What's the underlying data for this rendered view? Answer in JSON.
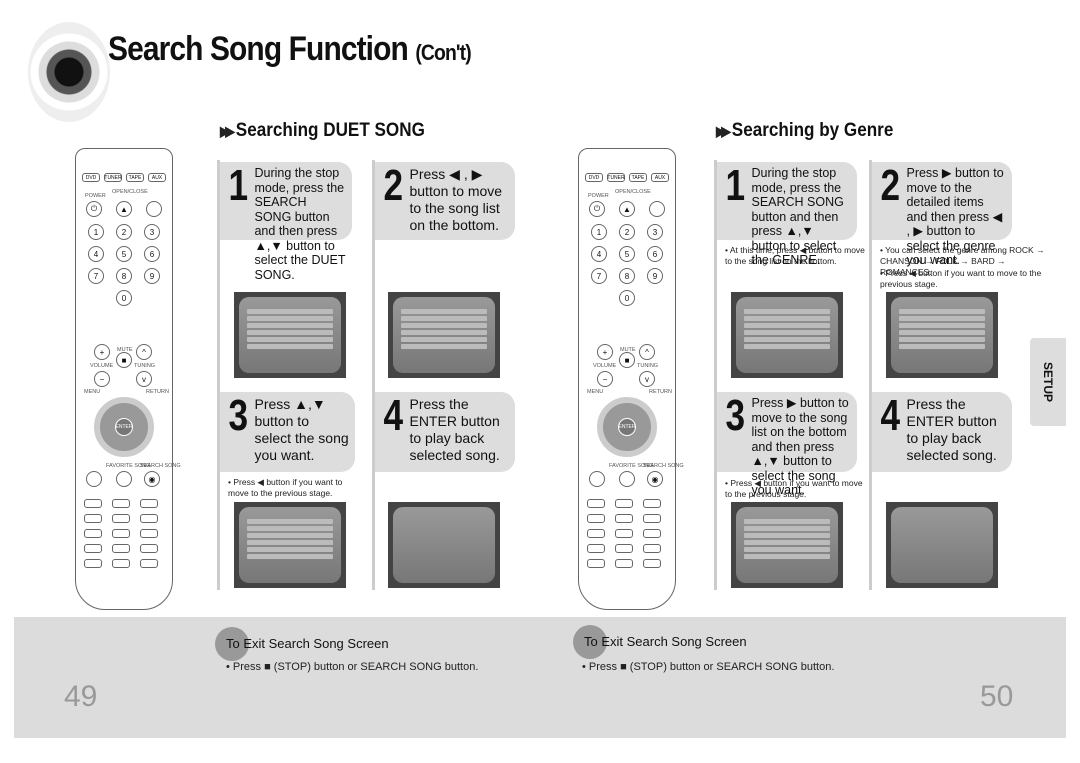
{
  "title": {
    "main": "Search Song Function",
    "suffix": "(Con't)"
  },
  "left": {
    "heading": "Searching DUET SONG",
    "steps": [
      {
        "n": "1",
        "text": "During the stop mode, press the SEARCH SONG button and then press ▲,▼ button to select the DUET SONG."
      },
      {
        "n": "2",
        "text": "Press ◀ , ▶ button to move to the song list on the bottom."
      },
      {
        "n": "3",
        "text": "Press ▲,▼ button to select the song you want."
      },
      {
        "n": "4",
        "text": "Press the ENTER button to play back selected song."
      }
    ],
    "note3": "• Press ◀ button if you want to move to the previous stage."
  },
  "right": {
    "heading": "Searching by Genre",
    "steps": [
      {
        "n": "1",
        "text": "During the stop mode, press the SEARCH SONG button and then press ▲,▼ button to select the GENRE."
      },
      {
        "n": "2",
        "text": "Press ▶ button to move to the detailed items and then press ◀ , ▶ button to select the genre you want."
      },
      {
        "n": "3",
        "text": "Press ▶ button to move to the song list on the bottom and then press ▲,▼ button to select the song you want."
      },
      {
        "n": "4",
        "text": "Press the ENTER button to play back selected song."
      }
    ],
    "note1": "• At this time, press ◀ button to move to the song list on the bottom.",
    "note2a": "• You can select the genre among ROCK → CHANSON → FOLK → BARD → ROMANCES.",
    "note2b": "• Press ◀ button if you want to move to the previous stage.",
    "note3": "• Press ◀ button if you want to move to the previous stage."
  },
  "remote": {
    "top_keys": [
      "DVD",
      "TUNER",
      "TAPE",
      "AUX"
    ],
    "numbers": [
      "1",
      "2",
      "3",
      "4",
      "5",
      "6",
      "7",
      "8",
      "9",
      "0"
    ],
    "labels": {
      "power": "POWER",
      "open": "OPEN/CLOSE",
      "volume": "VOLUME",
      "tuning": "TUNING",
      "mute": "MUTE",
      "menu": "MENU",
      "return": "RETURN",
      "enter": "ENTER",
      "favorite": "FAVORITE SONG",
      "search": "SEARCH SONG"
    }
  },
  "side_tab": "SETUP",
  "exit": {
    "heading": "To Exit Search Song Screen",
    "text": "• Press ■ (STOP) button or SEARCH SONG button."
  },
  "pages": {
    "left": "49",
    "right": "50"
  }
}
